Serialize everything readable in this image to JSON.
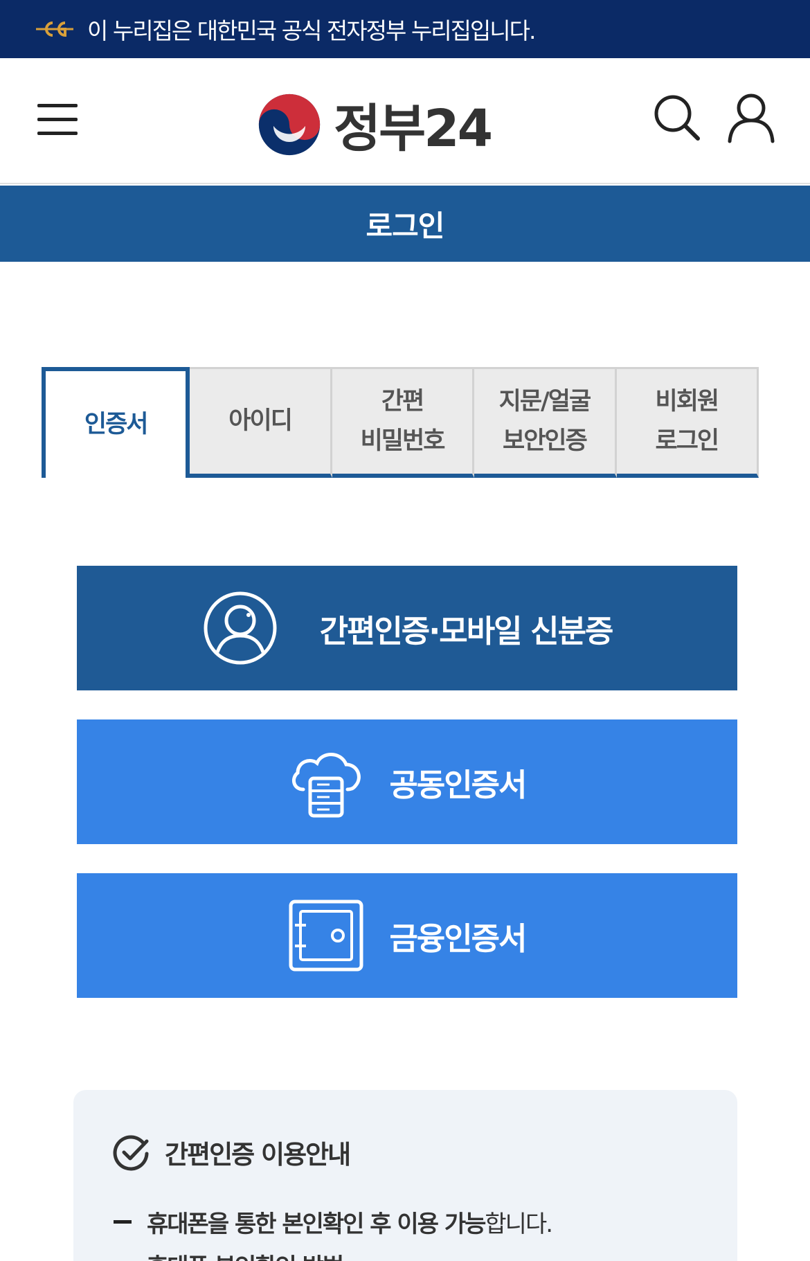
{
  "gov_banner": {
    "text": "이 누리집은 대한민국 공식 전자정부 누리집입니다.",
    "emblem_icon": "eg-emblem-icon"
  },
  "header": {
    "logo_text": "정부24",
    "menu_icon": "hamburger-menu-icon",
    "search_icon": "search-icon",
    "user_icon": "user-icon"
  },
  "page_title": "로그인",
  "tabs": [
    {
      "label": "인증서",
      "active": true
    },
    {
      "label": "아이디",
      "active": false
    },
    {
      "label": "간편\n비밀번호",
      "active": false
    },
    {
      "label": "지문/얼굴\n보안인증",
      "active": false
    },
    {
      "label": "비회원\n로그인",
      "active": false
    }
  ],
  "login_options": {
    "easy": {
      "label": "간편인증·모바일 신분증",
      "icon": "profile-circle-icon"
    },
    "joint": {
      "label": "공동인증서",
      "icon": "cloud-server-icon"
    },
    "finance": {
      "label": "금융인증서",
      "icon": "safe-icon"
    }
  },
  "info": {
    "title": "간편인증 이용안내",
    "items": [
      {
        "bold": "휴대폰을 통한 본인확인 후 이용 가능",
        "rest": "합니다."
      },
      {
        "bold": "휴대폰 본인확인 방법",
        "rest": ""
      }
    ]
  },
  "colors": {
    "banner_bg": "#0b2a66",
    "primary": "#1d5a96",
    "accent_blue": "#3683e6",
    "info_bg": "#eff3f8"
  }
}
